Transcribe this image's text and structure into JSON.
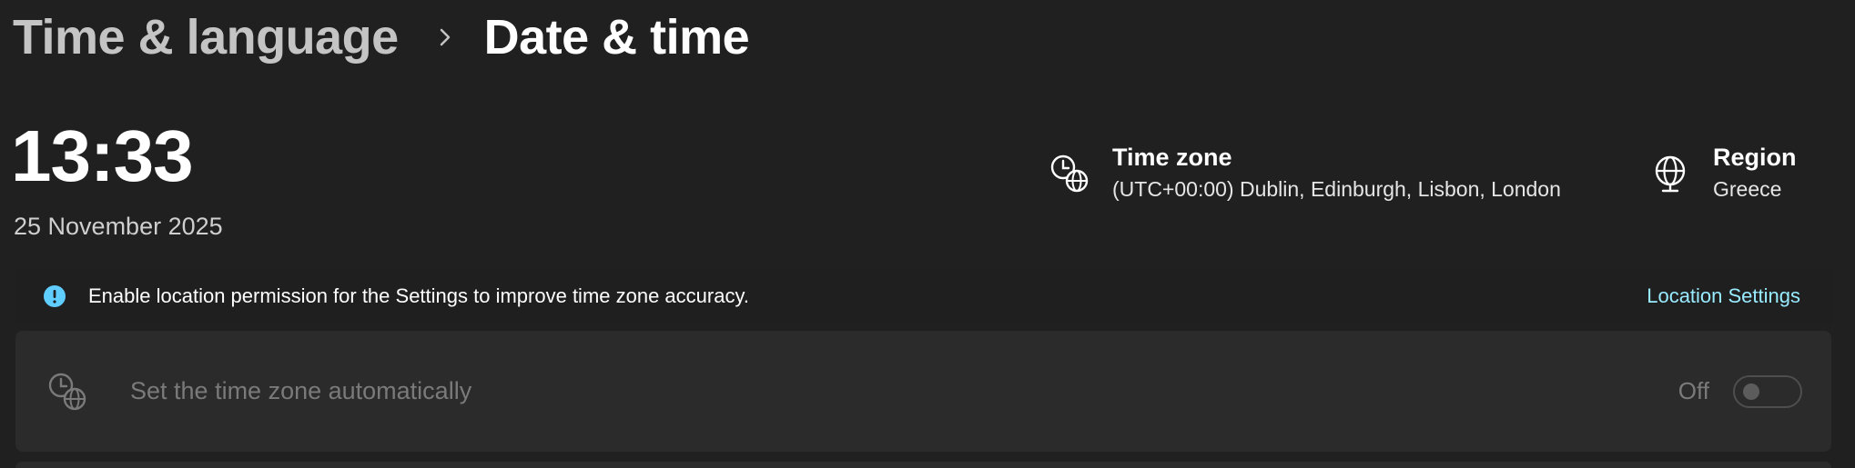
{
  "breadcrumb": {
    "parent": "Time & language",
    "current": "Date & time"
  },
  "clock": {
    "time": "13:33",
    "date": "25 November 2025"
  },
  "time_zone": {
    "title": "Time zone",
    "value": "(UTC+00:00) Dublin, Edinburgh, Lisbon, London",
    "icon": "clock-globe-icon"
  },
  "region": {
    "title": "Region",
    "value": "Greece",
    "icon": "globe-icon"
  },
  "infobar": {
    "icon": "info-icon",
    "message": "Enable location permission for the Settings to improve time zone accuracy.",
    "link": "Location Settings"
  },
  "auto_timezone": {
    "icon": "clock-globe-icon",
    "label": "Set the time zone automatically",
    "state_label": "Off",
    "enabled": false
  },
  "colors": {
    "background": "#202020",
    "card": "#2b2b2b",
    "link": "#99ebff",
    "info_accent": "#60cdff",
    "disabled_text": "#7a7a7a"
  }
}
